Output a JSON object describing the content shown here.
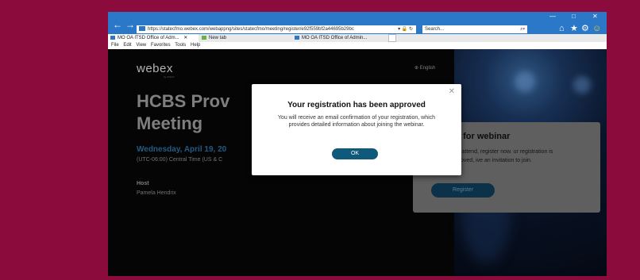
{
  "browser": {
    "url": "https://statecfmo.webex.com/webappng/sites/statecfmo/meeting/register/e92f559bf2a44695b29bc",
    "url_menu_glyph": "▾",
    "lock_glyph": "🔒",
    "refresh_glyph": "↻",
    "search_placeholder": "Search...",
    "search_glyph": "⌕▾",
    "back_glyph": "←",
    "forward_glyph": "→",
    "minimize_glyph": "—",
    "maximize_glyph": "□",
    "close_glyph": "✕",
    "home_glyph": "⌂",
    "star_glyph": "★",
    "gear_glyph": "⚙",
    "smiley_glyph": "☺",
    "tabs": [
      {
        "label": "MO OA ITSD Office of Adm...",
        "close": "✕"
      },
      {
        "label": "New tab"
      },
      {
        "label": "MO OA ITSD Office of Admin..."
      }
    ],
    "menu": [
      "File",
      "Edit",
      "View",
      "Favorites",
      "Tools",
      "Help"
    ]
  },
  "page": {
    "logo": "webex",
    "logo_sub": "by CISCO",
    "language": "⊕ English",
    "meeting_title_line1": "HCBS Prov",
    "meeting_title_line2": "Meeting",
    "date": "Wednesday, April 19, 20",
    "timezone": "(UTC-06:00) Central Time (US & C",
    "host_label": "Host",
    "host_name": "Pamela Hendrix"
  },
  "register_card": {
    "title": "ter for webinar",
    "text": "nt to attend, register now. ur registration is approved, ive an invitation to join.",
    "button": "Register"
  },
  "dialog": {
    "close_glyph": "✕",
    "title": "Your registration has been approved",
    "message": "You will receive an email confirmation of your registration, which provides detailed information about joining the webinar.",
    "ok": "OK"
  },
  "colors": {
    "desktop": "#8a0b3c",
    "titlebar": "#2b78c8",
    "date_accent": "#2c6ea0",
    "ok_button": "#0f5a7a"
  }
}
